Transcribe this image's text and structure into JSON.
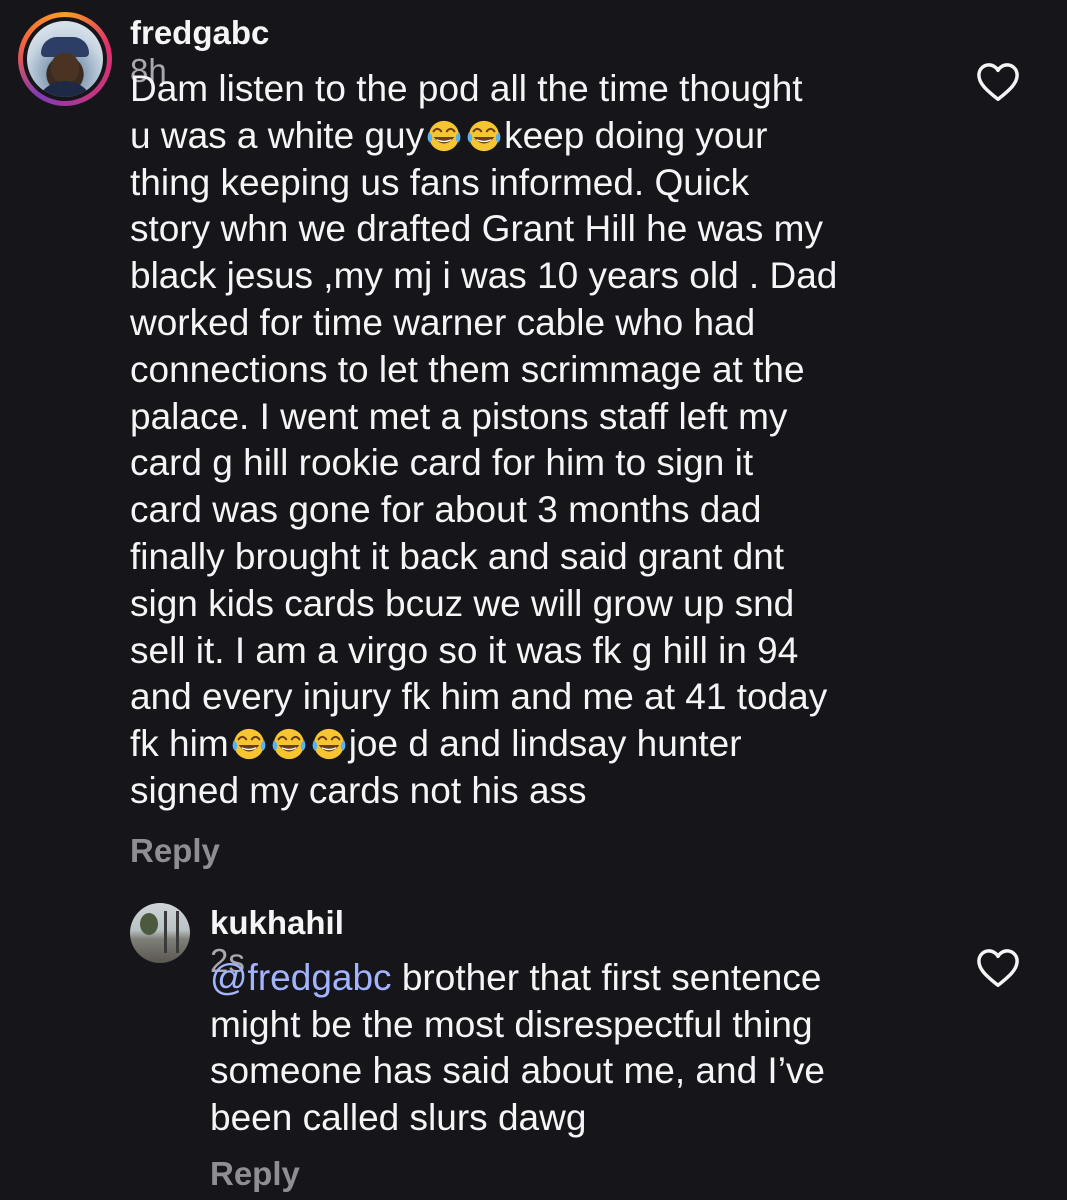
{
  "comments": [
    {
      "username": "fredgabc",
      "time": "8h",
      "segments": [
        {
          "text": "Dam listen to the pod all the time thought\nu was a white guy"
        },
        {
          "emoji": "laughing-tears"
        },
        {
          "emoji": "laughing-tears"
        },
        {
          "text": "keep doing your\nthing keeping us fans informed. Quick\nstory whn we drafted Grant Hill he was my\nblack jesus ,my mj i was 10 years old . Dad\nworked for time warner cable who had\nconnections to let them scrimmage at the\npalace. I went met a pistons staff left my\ncard g hill rookie card for him to sign it\ncard was gone for about 3 months dad\nfinally brought it back and said grant dnt\nsign kids cards bcuz we will grow up snd\nsell it. I am a  virgo so it was fk g hill in 94\nand every injury fk him and me at 41 today\nfk him"
        },
        {
          "emoji": "laughing-tears"
        },
        {
          "emoji": "laughing-tears"
        },
        {
          "emoji": "laughing-tears"
        },
        {
          "text": "joe d and lindsay hunter\nsigned my cards not his ass"
        }
      ],
      "reply_label": "Reply",
      "like_icon": "heart-outline-icon"
    },
    {
      "username": "kukhahil",
      "time": "2s",
      "mention": "@fredgabc",
      "text": " brother that first sentence\nmight be the most disrespectful thing\nsomeone has said about me, and I’ve\nbeen called slurs dawg",
      "reply_label": "Reply",
      "like_icon": "heart-outline-icon"
    }
  ],
  "colors": {
    "background": "#16161a",
    "text": "#f5f5f7",
    "muted": "#a8a8ae",
    "reply": "#8e8e93",
    "mention": "#a3b4ff"
  }
}
